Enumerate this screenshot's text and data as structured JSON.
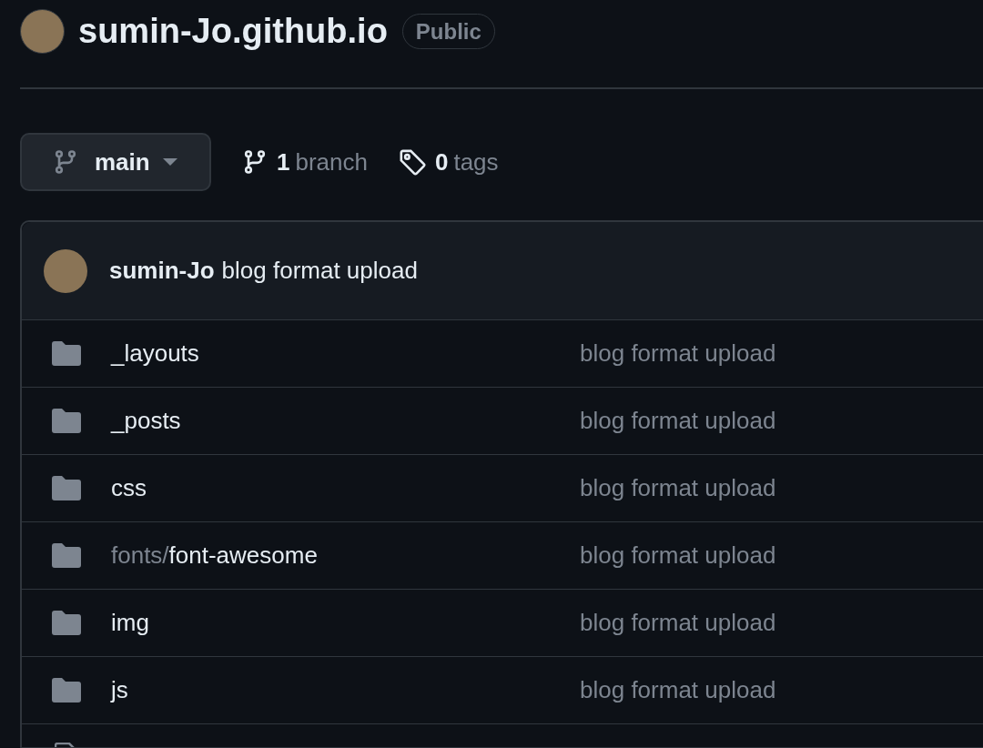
{
  "repo": {
    "name": "sumin-Jo.github.io",
    "visibility": "Public"
  },
  "branch_selector": {
    "label": "main"
  },
  "branches": {
    "count": "1",
    "label": "branch"
  },
  "tags": {
    "count": "0",
    "label": "tags"
  },
  "latest_commit": {
    "author": "sumin-Jo",
    "message": "blog format upload"
  },
  "files": [
    {
      "kind": "folder",
      "name": "_layouts",
      "commit": "blog format upload"
    },
    {
      "kind": "folder",
      "name": "_posts",
      "commit": "blog format upload"
    },
    {
      "kind": "folder",
      "name": "css",
      "commit": "blog format upload"
    },
    {
      "kind": "folder",
      "prefix": "fonts/",
      "name": "font-awesome",
      "commit": "blog format upload"
    },
    {
      "kind": "folder",
      "name": "img",
      "commit": "blog format upload"
    },
    {
      "kind": "folder",
      "name": "js",
      "commit": "blog format upload"
    },
    {
      "kind": "file"
    }
  ]
}
